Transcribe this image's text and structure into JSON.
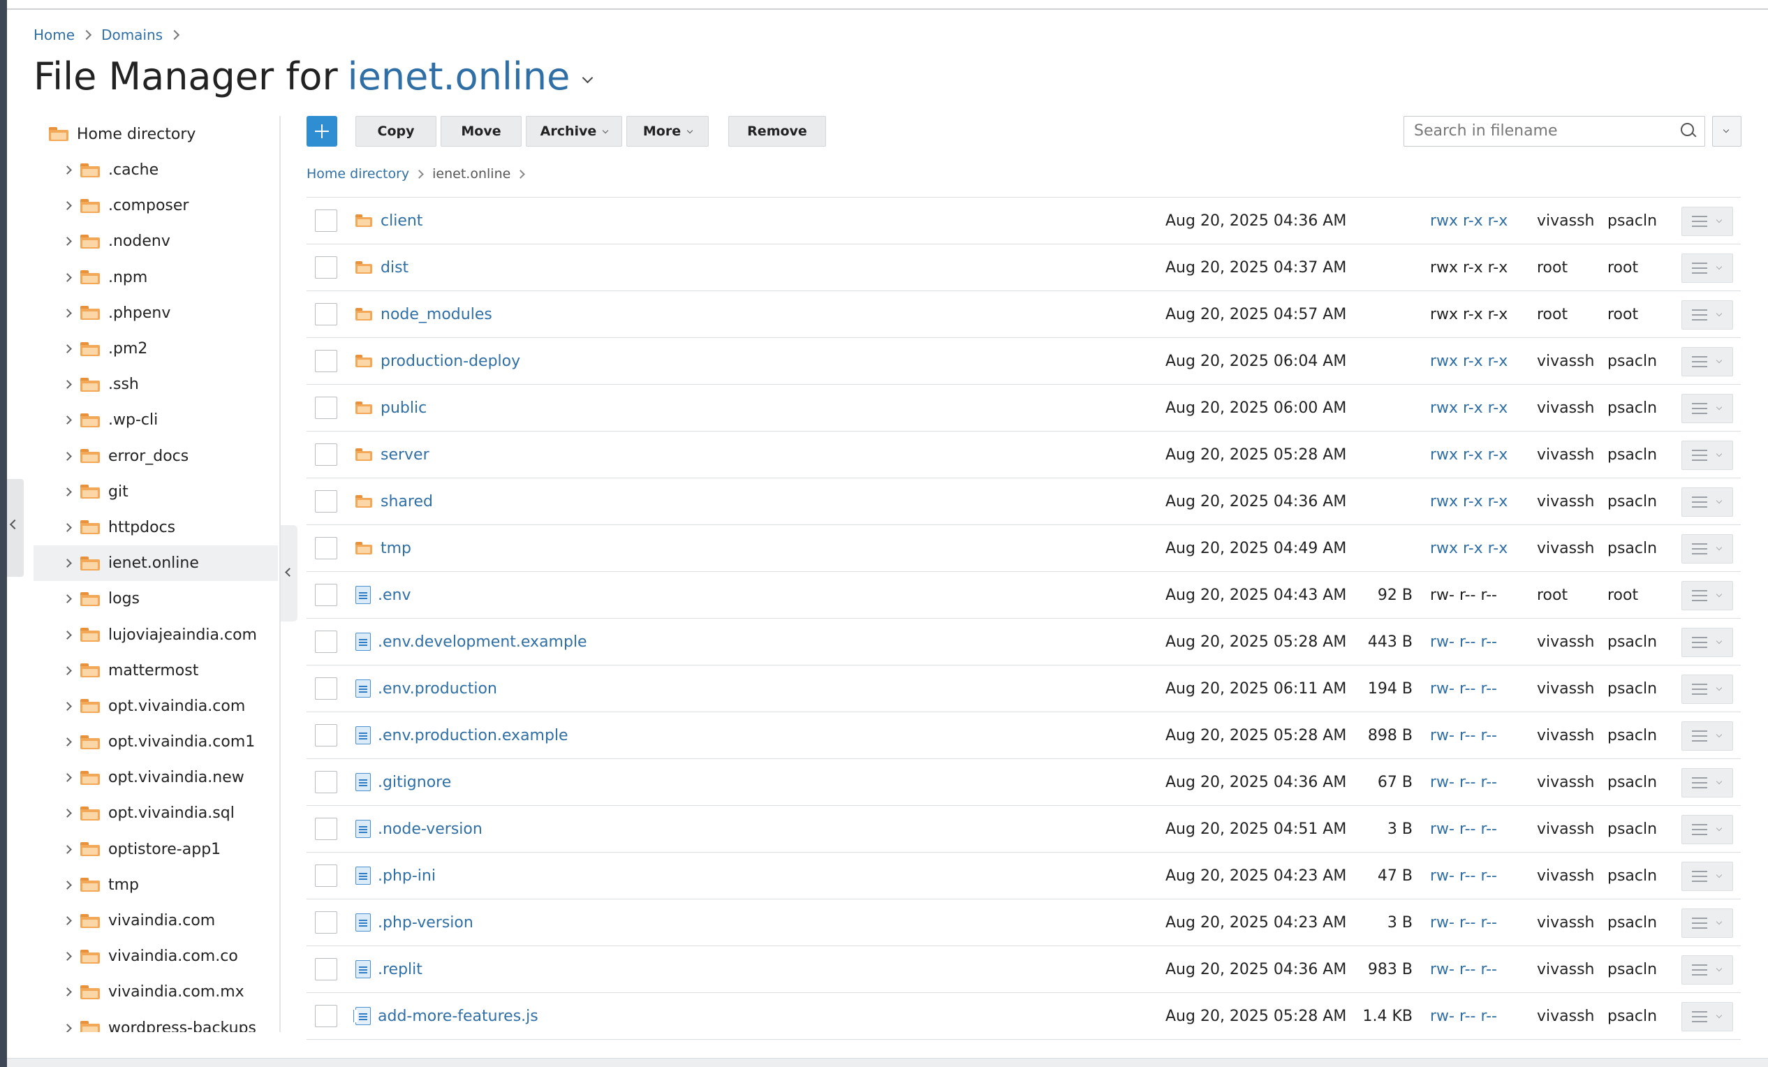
{
  "breadcrumb": {
    "home": "Home",
    "domains": "Domains"
  },
  "title": {
    "prefix": "File Manager for",
    "domain": "ienet.online"
  },
  "tree": {
    "root": "Home directory",
    "items": [
      ".cache",
      ".composer",
      ".nodenv",
      ".npm",
      ".phpenv",
      ".pm2",
      ".ssh",
      ".wp-cli",
      "error_docs",
      "git",
      "httpdocs",
      "ienet.online",
      "logs",
      "lujoviajeaindia.com",
      "mattermost",
      "opt.vivaindia.com",
      "opt.vivaindia.com1",
      "opt.vivaindia.new",
      "opt.vivaindia.sql",
      "optistore-app1",
      "tmp",
      "vivaindia.com",
      "vivaindia.com.co",
      "vivaindia.com.mx",
      "wordpress-backups"
    ],
    "selected": "ienet.online"
  },
  "toolbar": {
    "copy": "Copy",
    "move": "Move",
    "archive": "Archive",
    "more": "More",
    "remove": "Remove"
  },
  "search": {
    "placeholder": "Search in filename"
  },
  "path": {
    "root": "Home directory",
    "current": "ienet.online"
  },
  "rows": [
    {
      "type": "folder",
      "name": "client",
      "date": "Aug 20, 2025 04:36 AM",
      "size": "",
      "perm": "rwx r-x r-x",
      "perm_link": true,
      "user": "vivassh",
      "group": "psacln"
    },
    {
      "type": "folder",
      "name": "dist",
      "date": "Aug 20, 2025 04:37 AM",
      "size": "",
      "perm": "rwx r-x r-x",
      "perm_link": false,
      "user": "root",
      "group": "root"
    },
    {
      "type": "folder",
      "name": "node_modules",
      "date": "Aug 20, 2025 04:57 AM",
      "size": "",
      "perm": "rwx r-x r-x",
      "perm_link": false,
      "user": "root",
      "group": "root"
    },
    {
      "type": "folder",
      "name": "production-deploy",
      "date": "Aug 20, 2025 06:04 AM",
      "size": "",
      "perm": "rwx r-x r-x",
      "perm_link": true,
      "user": "vivassh",
      "group": "psacln"
    },
    {
      "type": "folder",
      "name": "public",
      "date": "Aug 20, 2025 06:00 AM",
      "size": "",
      "perm": "rwx r-x r-x",
      "perm_link": true,
      "user": "vivassh",
      "group": "psacln"
    },
    {
      "type": "folder",
      "name": "server",
      "date": "Aug 20, 2025 05:28 AM",
      "size": "",
      "perm": "rwx r-x r-x",
      "perm_link": true,
      "user": "vivassh",
      "group": "psacln"
    },
    {
      "type": "folder",
      "name": "shared",
      "date": "Aug 20, 2025 04:36 AM",
      "size": "",
      "perm": "rwx r-x r-x",
      "perm_link": true,
      "user": "vivassh",
      "group": "psacln"
    },
    {
      "type": "folder",
      "name": "tmp",
      "date": "Aug 20, 2025 04:49 AM",
      "size": "",
      "perm": "rwx r-x r-x",
      "perm_link": true,
      "user": "vivassh",
      "group": "psacln"
    },
    {
      "type": "file",
      "name": ".env",
      "date": "Aug 20, 2025 04:43 AM",
      "size": "92 B",
      "perm": "rw- r-- r--",
      "perm_link": false,
      "user": "root",
      "group": "root"
    },
    {
      "type": "file",
      "name": ".env.development.example",
      "date": "Aug 20, 2025 05:28 AM",
      "size": "443 B",
      "perm": "rw- r-- r--",
      "perm_link": true,
      "user": "vivassh",
      "group": "psacln"
    },
    {
      "type": "file",
      "name": ".env.production",
      "date": "Aug 20, 2025 06:11 AM",
      "size": "194 B",
      "perm": "rw- r-- r--",
      "perm_link": true,
      "user": "vivassh",
      "group": "psacln"
    },
    {
      "type": "file",
      "name": ".env.production.example",
      "date": "Aug 20, 2025 05:28 AM",
      "size": "898 B",
      "perm": "rw- r-- r--",
      "perm_link": true,
      "user": "vivassh",
      "group": "psacln"
    },
    {
      "type": "file",
      "name": ".gitignore",
      "date": "Aug 20, 2025 04:36 AM",
      "size": "67 B",
      "perm": "rw- r-- r--",
      "perm_link": true,
      "user": "vivassh",
      "group": "psacln"
    },
    {
      "type": "file",
      "name": ".node-version",
      "date": "Aug 20, 2025 04:51 AM",
      "size": "3 B",
      "perm": "rw- r-- r--",
      "perm_link": true,
      "user": "vivassh",
      "group": "psacln"
    },
    {
      "type": "file",
      "name": ".php-ini",
      "date": "Aug 20, 2025 04:23 AM",
      "size": "47 B",
      "perm": "rw- r-- r--",
      "perm_link": true,
      "user": "vivassh",
      "group": "psacln"
    },
    {
      "type": "file",
      "name": ".php-version",
      "date": "Aug 20, 2025 04:23 AM",
      "size": "3 B",
      "perm": "rw- r-- r--",
      "perm_link": true,
      "user": "vivassh",
      "group": "psacln"
    },
    {
      "type": "file",
      "name": ".replit",
      "date": "Aug 20, 2025 04:36 AM",
      "size": "983 B",
      "perm": "rw- r-- r--",
      "perm_link": true,
      "user": "vivassh",
      "group": "psacln"
    },
    {
      "type": "js",
      "name": "add-more-features.js",
      "date": "Aug 20, 2025 05:28 AM",
      "size": "1.4 KB",
      "perm": "rw- r-- r--",
      "perm_link": true,
      "user": "vivassh",
      "group": "psacln"
    }
  ],
  "colors": {
    "accent": "#2f8ed1",
    "link": "#2f6fa6",
    "folder": "#f3a858",
    "sidebar_dark": "#3d4755"
  }
}
